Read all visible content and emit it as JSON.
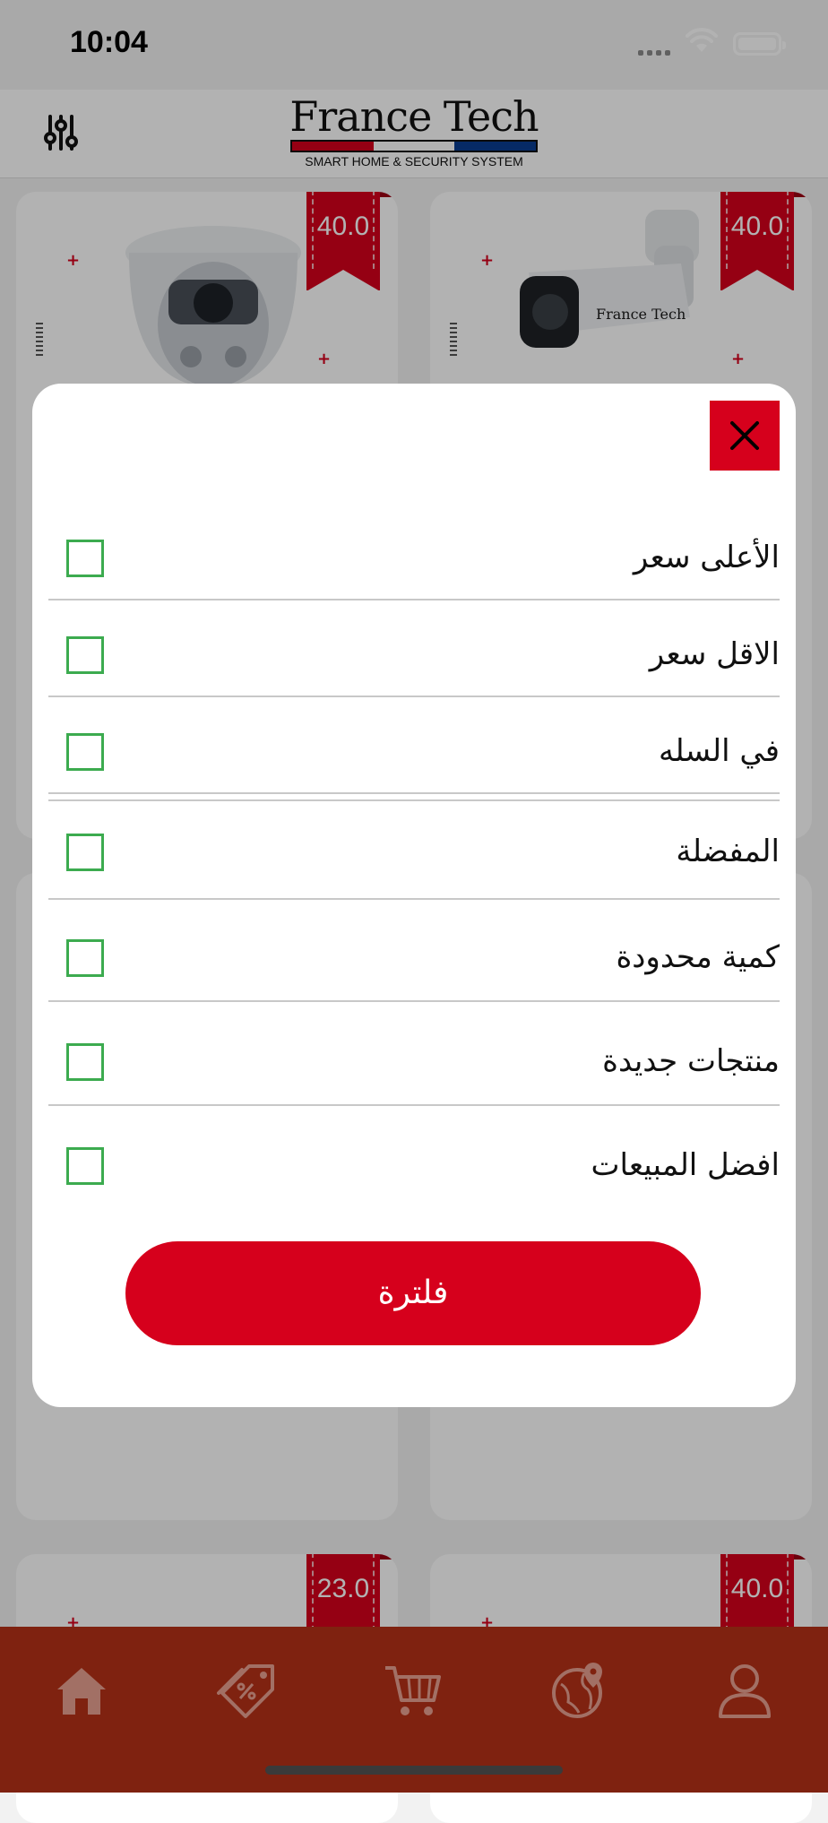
{
  "status_bar": {
    "time": "10:04"
  },
  "header": {
    "logo_title": "France Tech",
    "logo_subtitle": "SMART HOME & SECURITY SYSTEM"
  },
  "products": [
    {
      "price": "40.0",
      "image": "dome-camera"
    },
    {
      "price": "40.0",
      "image": "bullet-camera"
    },
    {
      "price": "23.0",
      "image": "camera"
    },
    {
      "price": "40.0",
      "image": "camera"
    }
  ],
  "filter_modal": {
    "options": [
      {
        "label": "الأعلى سعر",
        "checked": false
      },
      {
        "label": "الاقل سعر",
        "checked": false
      },
      {
        "label": "في السله",
        "checked": false
      },
      {
        "label": "المفضلة",
        "checked": false
      },
      {
        "label": "كمية محدودة",
        "checked": false
      },
      {
        "label": "منتجات جديدة",
        "checked": false
      },
      {
        "label": "افضل المبيعات",
        "checked": false
      }
    ],
    "apply_label": "فلترة"
  },
  "tab_bar": {
    "items": [
      "home-icon",
      "offers-tag-icon",
      "cart-icon",
      "location-globe-icon",
      "profile-icon"
    ]
  },
  "colors": {
    "brand_red": "#d6001c",
    "tab_bar": "#b73118",
    "checkbox_green": "#3cab4f"
  }
}
